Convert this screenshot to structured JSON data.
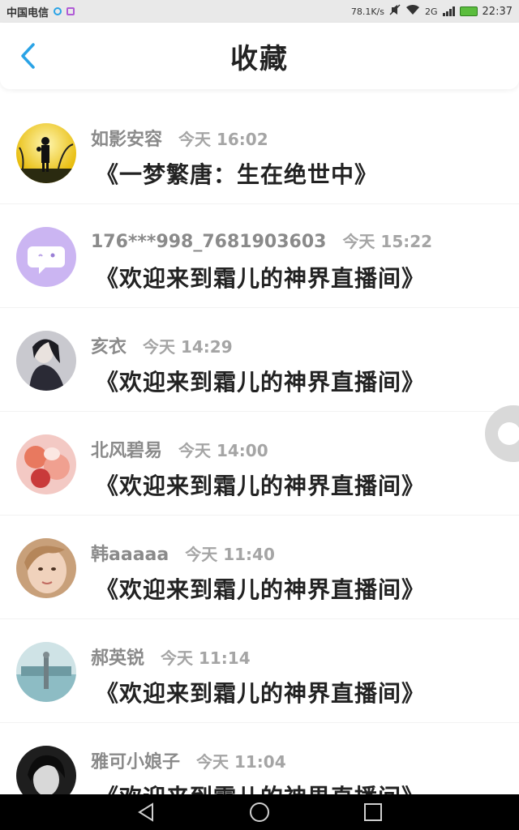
{
  "status_bar": {
    "carrier": "中国电信",
    "net_speed": "78.1K/s",
    "network": "2G",
    "time": "22:37"
  },
  "header": {
    "title": "收藏",
    "back_icon": "chevron-left-icon"
  },
  "colors": {
    "accent": "#2aa3e6",
    "title": "#222222",
    "meta": "#8a8a8a",
    "time": "#a5a5a5"
  },
  "favorites": [
    {
      "name": "如影安容",
      "time": "今天 16:02",
      "room": "《一梦繁唐：生在绝世中》",
      "avatar": "silhouette-avatar"
    },
    {
      "name": "176***998_7681903603",
      "time": "今天 15:22",
      "room": "《欢迎来到霜儿的神界直播间》",
      "avatar": "chat-bubble-avatar"
    },
    {
      "name": "亥衣",
      "time": "今天 14:29",
      "room": "《欢迎来到霜儿的神界直播间》",
      "avatar": "portrait-avatar"
    },
    {
      "name": "北风碧易",
      "time": "今天 14:00",
      "room": "《欢迎来到霜儿的神界直播间》",
      "avatar": "floral-avatar"
    },
    {
      "name": "韩aaaaa",
      "time": "今天 11:40",
      "room": "《欢迎来到霜儿的神界直播间》",
      "avatar": "child-avatar"
    },
    {
      "name": "郝英锐",
      "time": "今天 11:14",
      "room": "《欢迎来到霜儿的神界直播间》",
      "avatar": "scenery-avatar"
    },
    {
      "name": "雅可小娘子",
      "time": "今天 11:04",
      "room": "《欢迎来到霜儿的神界直播间》",
      "avatar": "bw-portrait-avatar"
    }
  ]
}
